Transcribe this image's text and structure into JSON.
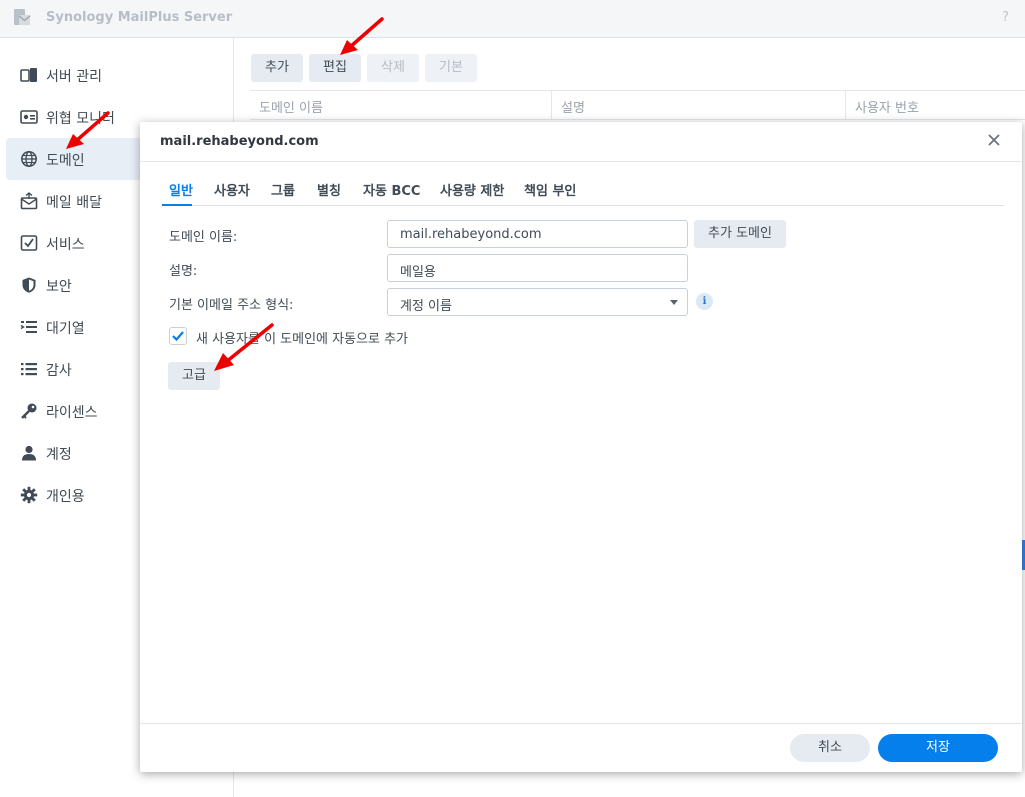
{
  "app": {
    "title": "Synology MailPlus Server",
    "help_label": "?"
  },
  "sidebar": {
    "items": [
      {
        "label": "서버 관리",
        "icon": "server-manage-icon"
      },
      {
        "label": "위협 모니터",
        "icon": "threat-monitor-icon"
      },
      {
        "label": "도메인",
        "icon": "globe-icon",
        "active": true
      },
      {
        "label": "메일 배달",
        "icon": "mail-delivery-icon"
      },
      {
        "label": "서비스",
        "icon": "service-icon"
      },
      {
        "label": "보안",
        "icon": "shield-icon"
      },
      {
        "label": "대기열",
        "icon": "queue-icon"
      },
      {
        "label": "감사",
        "icon": "audit-list-icon"
      },
      {
        "label": "라이센스",
        "icon": "key-icon"
      },
      {
        "label": "계정",
        "icon": "user-icon"
      },
      {
        "label": "개인용",
        "icon": "gear-icon"
      }
    ]
  },
  "toolbar": {
    "add_label": "추가",
    "edit_label": "편집",
    "delete_label": "삭제",
    "default_label": "기본"
  },
  "grid": {
    "columns": [
      "도메인 이름",
      "설명",
      "사용자 번호"
    ]
  },
  "dialog": {
    "title": "mail.rehabeyond.com",
    "tabs": [
      "일반",
      "사용자",
      "그룹",
      "별칭",
      "자동 BCC",
      "사용량 제한",
      "책임 부인"
    ],
    "form": {
      "domain_name_label": "도메인 이름:",
      "domain_name_value": "mail.rehabeyond.com",
      "add_domain_label": "추가 도메인",
      "description_label": "설명:",
      "description_value": "메일용",
      "address_format_label": "기본 이메일 주소 형식:",
      "address_format_value": "계정 이름",
      "info_label": "i",
      "auto_add_label": "새 사용자를 이 도메인에 자동으로 추가",
      "auto_add_checked": true,
      "advanced_label": "고급"
    },
    "footer": {
      "cancel_label": "취소",
      "save_label": "저장"
    }
  },
  "colors": {
    "accent": "#057feb",
    "annotation_arrow": "#ee0000"
  }
}
